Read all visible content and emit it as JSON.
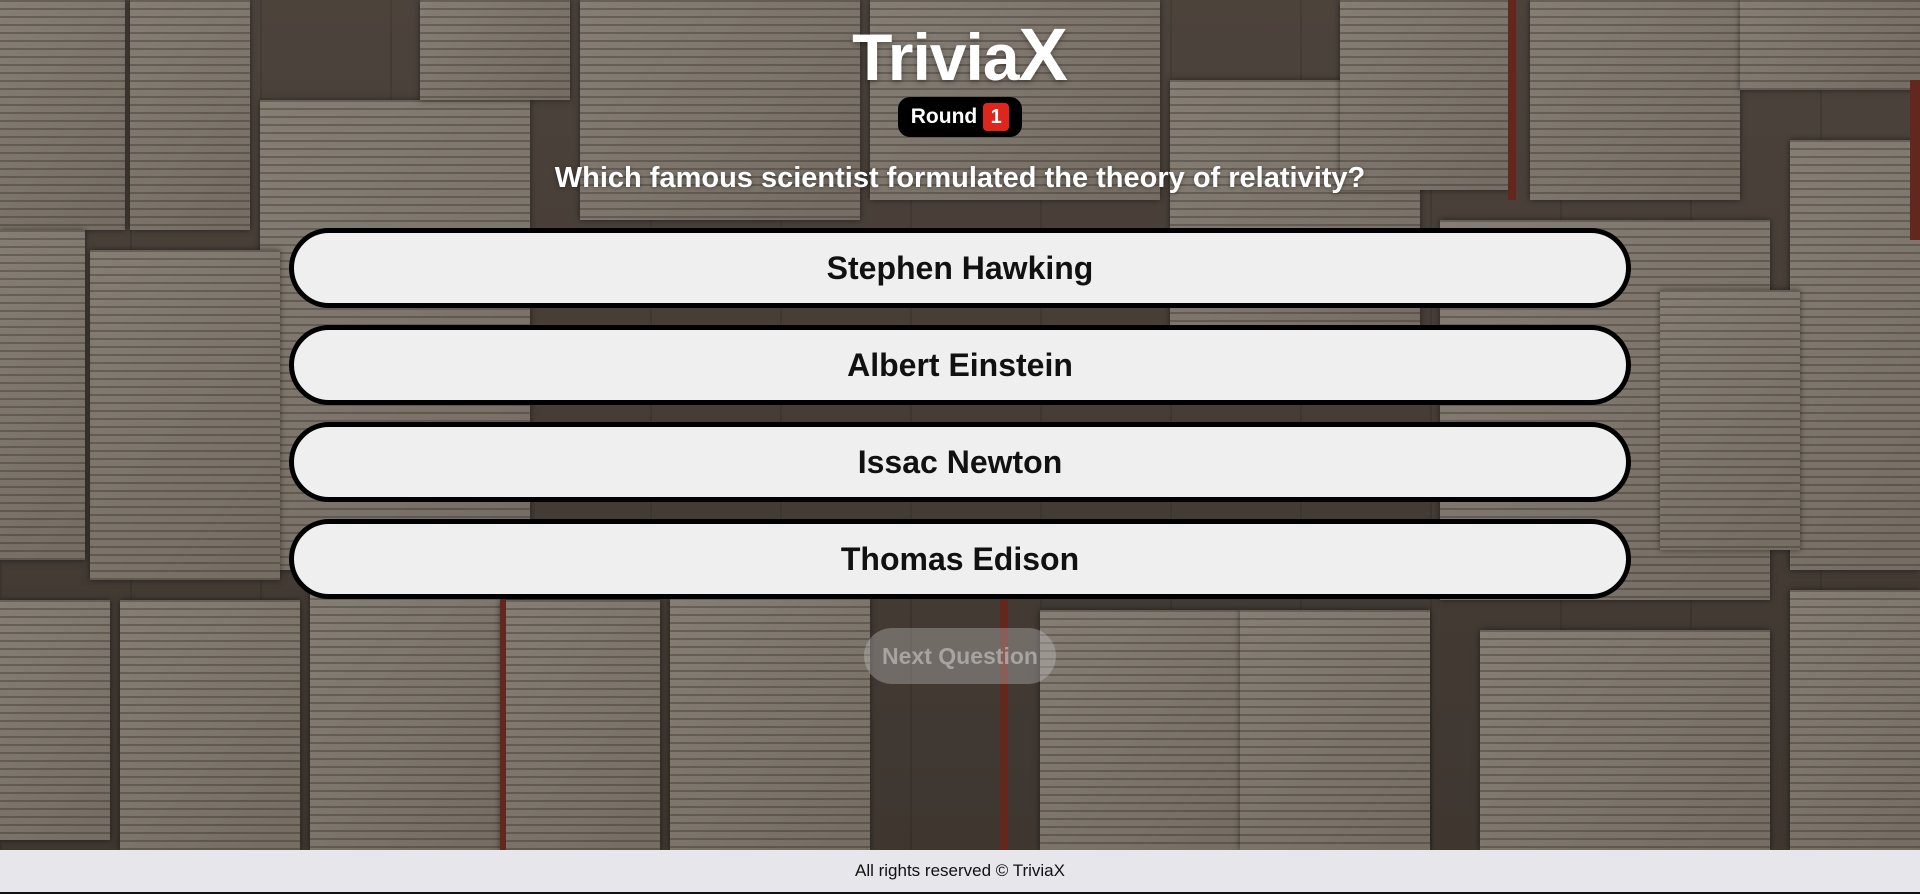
{
  "app": {
    "logo_main": "Trivia",
    "logo_accent": "X"
  },
  "round": {
    "label": "Round",
    "number": "1"
  },
  "question": {
    "text": "Which famous scientist formulated the theory of relativity?"
  },
  "answers": [
    {
      "label": "Stephen Hawking"
    },
    {
      "label": "Albert Einstein"
    },
    {
      "label": "Issac Newton"
    },
    {
      "label": "Thomas Edison"
    }
  ],
  "next_button": {
    "label": "Next Question",
    "enabled": false
  },
  "footer": {
    "text": "All rights reserved © TriviaX"
  },
  "colors": {
    "badge_bg": "#000000",
    "round_number_bg": "#e0261c",
    "answer_bg": "#efefef",
    "answer_border": "#000000",
    "footer_bg": "#e7e6ea"
  }
}
